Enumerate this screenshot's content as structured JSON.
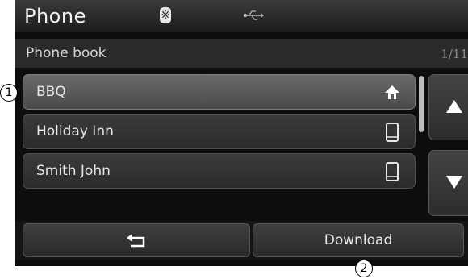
{
  "header": {
    "title": "Phone",
    "bluetooth_icon": "bluetooth-icon",
    "usb_icon": "usb-icon"
  },
  "section": {
    "title": "Phone book",
    "page_indicator": "1/11"
  },
  "contacts": [
    {
      "name": "BBQ",
      "type_icon": "home-icon",
      "selected": true
    },
    {
      "name": "Holiday Inn",
      "type_icon": "mobile-phone-icon",
      "selected": false
    },
    {
      "name": "Smith John",
      "type_icon": "mobile-phone-icon",
      "selected": false
    }
  ],
  "scroll": {
    "up_icon": "arrow-up-icon",
    "down_icon": "arrow-down-icon"
  },
  "footer": {
    "back_icon": "back-arrow-icon",
    "download_label": "Download"
  },
  "callouts": [
    "1",
    "2"
  ],
  "colors": {
    "background": "#0d0d0d",
    "text": "#e8e8e8",
    "selected_row": "#5a5a5a"
  }
}
